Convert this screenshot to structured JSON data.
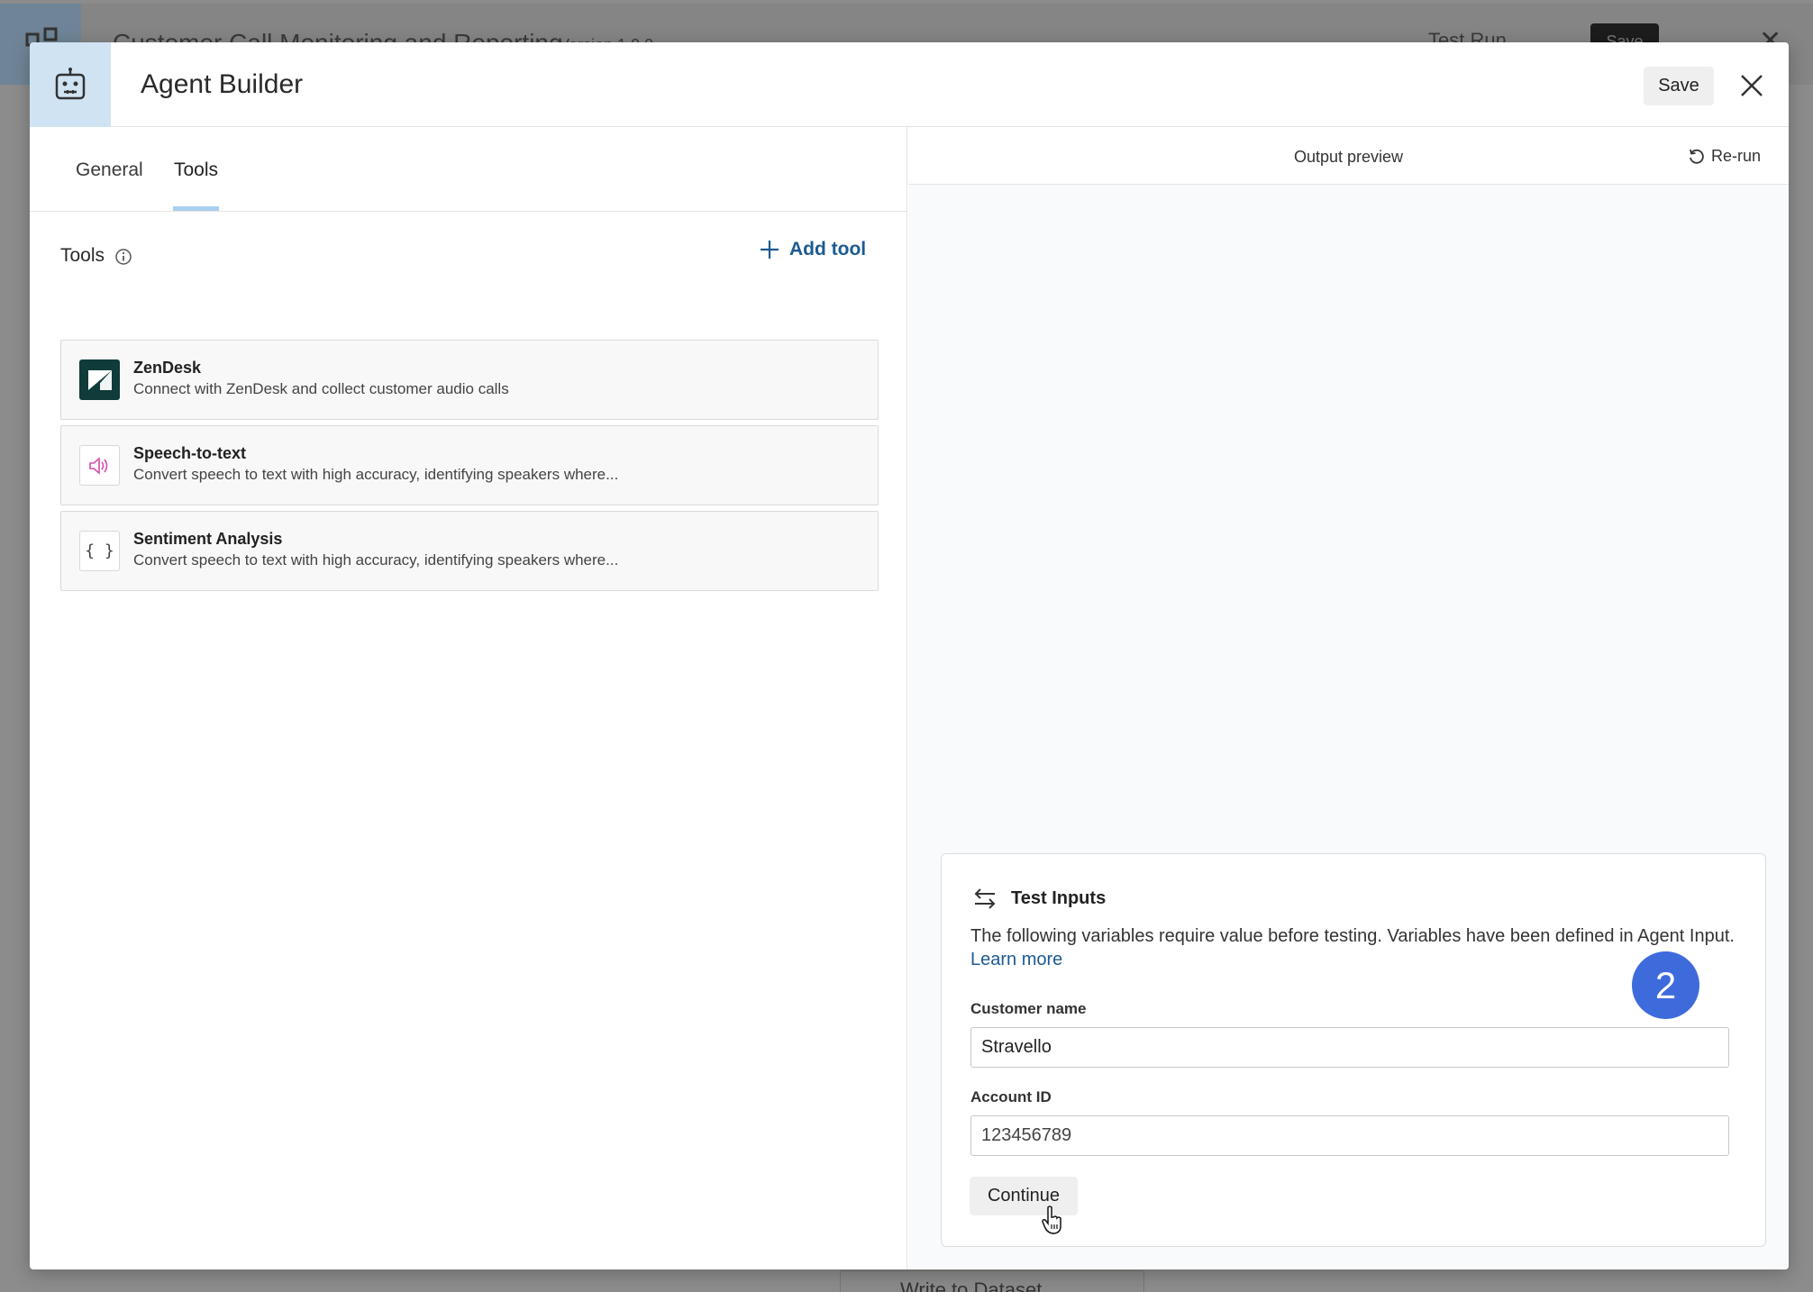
{
  "background": {
    "title": "Customer Call Monitoring and Reporting",
    "version": "Version 1.0.0",
    "test_run_label": "Test Run",
    "save_label": "Save",
    "node_label": "Write to Dataset"
  },
  "modal": {
    "title": "Agent Builder",
    "save_label": "Save"
  },
  "tabs": [
    {
      "label": "General",
      "active": false
    },
    {
      "label": "Tools",
      "active": true
    }
  ],
  "tools_section": {
    "label": "Tools",
    "add_tool_label": "Add tool",
    "items": [
      {
        "name": "ZenDesk",
        "description": "Connect with ZenDesk and collect customer audio calls",
        "icon": "zendesk-logo-icon"
      },
      {
        "name": "Speech-to-text",
        "description": "Convert speech to text with high accuracy, identifying speakers where...",
        "icon": "speaker-icon"
      },
      {
        "name": "Sentiment Analysis",
        "description": "Convert speech to text with high accuracy, identifying speakers where...",
        "icon": "braces-icon"
      }
    ]
  },
  "output_preview": {
    "title": "Output preview",
    "rerun_label": "Re-run"
  },
  "test_inputs": {
    "title": "Test Inputs",
    "description": "The following variables require value before testing. Variables have been defined in Agent Input.",
    "learn_more_label": "Learn more",
    "fields": [
      {
        "label": "Customer name",
        "value": "Stravello"
      },
      {
        "label": "Account ID",
        "value": "123456789"
      }
    ],
    "continue_label": "Continue"
  },
  "step_badge": "2",
  "colors": {
    "accent": "#1c5a92",
    "tab_underline": "#a9cff0",
    "badge": "#3e6bdc",
    "header_icon_bg": "#cfe3f3",
    "zendesk_bg": "#0f3b3a"
  }
}
